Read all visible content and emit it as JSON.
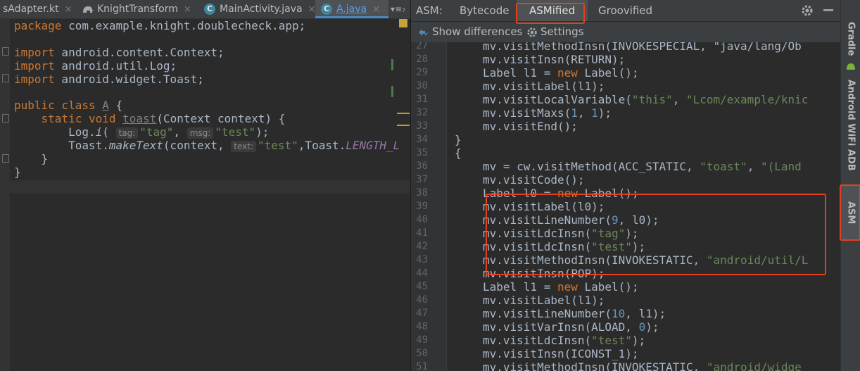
{
  "editor_tabs": [
    {
      "label": "sAdapter.kt",
      "close": "×"
    },
    {
      "label": "KnightTransform",
      "close": "×"
    },
    {
      "label": "MainActivity.java",
      "close": "×"
    },
    {
      "label": "A.java",
      "close": "×"
    }
  ],
  "tab_overflow": "▾≡₇",
  "source": {
    "package_kw": "package",
    "package_name": " com.example.knight.doublecheck.app;",
    "import_kw": "import",
    "imports": [
      " android.content.Context;",
      " android.util.Log;",
      " android.widget.Toast;"
    ],
    "class_decl_kw": "public class",
    "class_name": "A",
    "class_open": " {",
    "method_kw": "static void",
    "method_name": "toast",
    "method_sig": "(Context context) {",
    "log_call": "Log.",
    "log_method": "i",
    "paren_open": "(",
    "hint_tag": "tag:",
    "str_tag": "\"tag\"",
    "comma": ",",
    "hint_msg": "msg:",
    "str_test": "\"test\"",
    "close_stmt": ");",
    "toast_call": "Toast.",
    "toast_method": "makeText",
    "toast_args": "(context,",
    "hint_text": "text:",
    "str_test2": "\"test\"",
    "toast_rest": ",Toast.",
    "toast_const": "LENGTH_L",
    "inner_close": "}",
    "outer_close": "}"
  },
  "asm_header": {
    "label": "ASM:",
    "tabs": [
      "Bytecode",
      "ASMified",
      "Groovified"
    ],
    "selected": "ASMified"
  },
  "asm_toolbar": {
    "show_differences": "Show differences",
    "settings": "Settings"
  },
  "asm_lines": [
    {
      "n": "27",
      "text": "mv.visitMethodInsn(INVOKESPECIAL, \"java/lang/Ob"
    },
    {
      "n": "28",
      "text": "mv.visitInsn(RETURN);"
    },
    {
      "n": "29",
      "pre": "Label l1 = ",
      "kw": "new",
      "post": " Label();"
    },
    {
      "n": "30",
      "text": "mv.visitLabel(l1);"
    },
    {
      "n": "31",
      "pre": "mv.visitLocalVariable(",
      "s1": "\"this\"",
      "mid": ", ",
      "s2": "\"Lcom/example/knic"
    },
    {
      "n": "32",
      "pre": "mv.visitMaxs(",
      "a": "1",
      "mid": ", ",
      "b": "1",
      "post": ");"
    },
    {
      "n": "33",
      "text": "mv.visitEnd();"
    },
    {
      "n": "34",
      "text": "}"
    },
    {
      "n": "35",
      "text": "{"
    },
    {
      "n": "36",
      "pre": "mv = cw.visitMethod(ACC_STATIC, ",
      "s1": "\"toast\"",
      "mid": ", ",
      "s2": "\"(Land"
    },
    {
      "n": "37",
      "text": "mv.visitCode();"
    },
    {
      "n": "38",
      "pre": "Label l0 = ",
      "kw": "new",
      "post": " Label();"
    },
    {
      "n": "39",
      "text": "mv.visitLabel(l0);"
    },
    {
      "n": "40",
      "pre": "mv.visitLineNumber(",
      "a": "9",
      "mid": ", l0);"
    },
    {
      "n": "41",
      "pre": "mv.visitLdcInsn(",
      "s1": "\"tag\"",
      "post": ");"
    },
    {
      "n": "42",
      "pre": "mv.visitLdcInsn(",
      "s1": "\"test\"",
      "post": ");"
    },
    {
      "n": "43",
      "pre": "mv.visitMethodInsn(INVOKESTATIC, ",
      "s1": "\"android/util/L"
    },
    {
      "n": "44",
      "text": "mv.visitInsn(POP);"
    },
    {
      "n": "45",
      "pre": "Label l1 = ",
      "kw": "new",
      "post": " Label();"
    },
    {
      "n": "46",
      "text": "mv.visitLabel(l1);"
    },
    {
      "n": "47",
      "pre": "mv.visitLineNumber(",
      "a": "10",
      "mid": ", l1);"
    },
    {
      "n": "48",
      "pre": "mv.visitVarInsn(ALOAD, ",
      "a": "0",
      "mid": ");"
    },
    {
      "n": "49",
      "pre": "mv.visitLdcInsn(",
      "s1": "\"test\"",
      "post": ");"
    },
    {
      "n": "50",
      "text": "mv.visitInsn(ICONST_1);"
    },
    {
      "n": "51",
      "pre": "mv.visitMethodInsn(INVOKESTATIC, ",
      "s1": "\"android/widge"
    }
  ],
  "side_tabs": {
    "gradle": "Gradle",
    "adb": "Android WiFi ADB",
    "asm": "ASM"
  },
  "colors": {
    "accent": "#4a88c7",
    "highlight": "#e2401f",
    "keyword": "#cc7832",
    "string": "#6a8759",
    "number": "#6897bb"
  }
}
